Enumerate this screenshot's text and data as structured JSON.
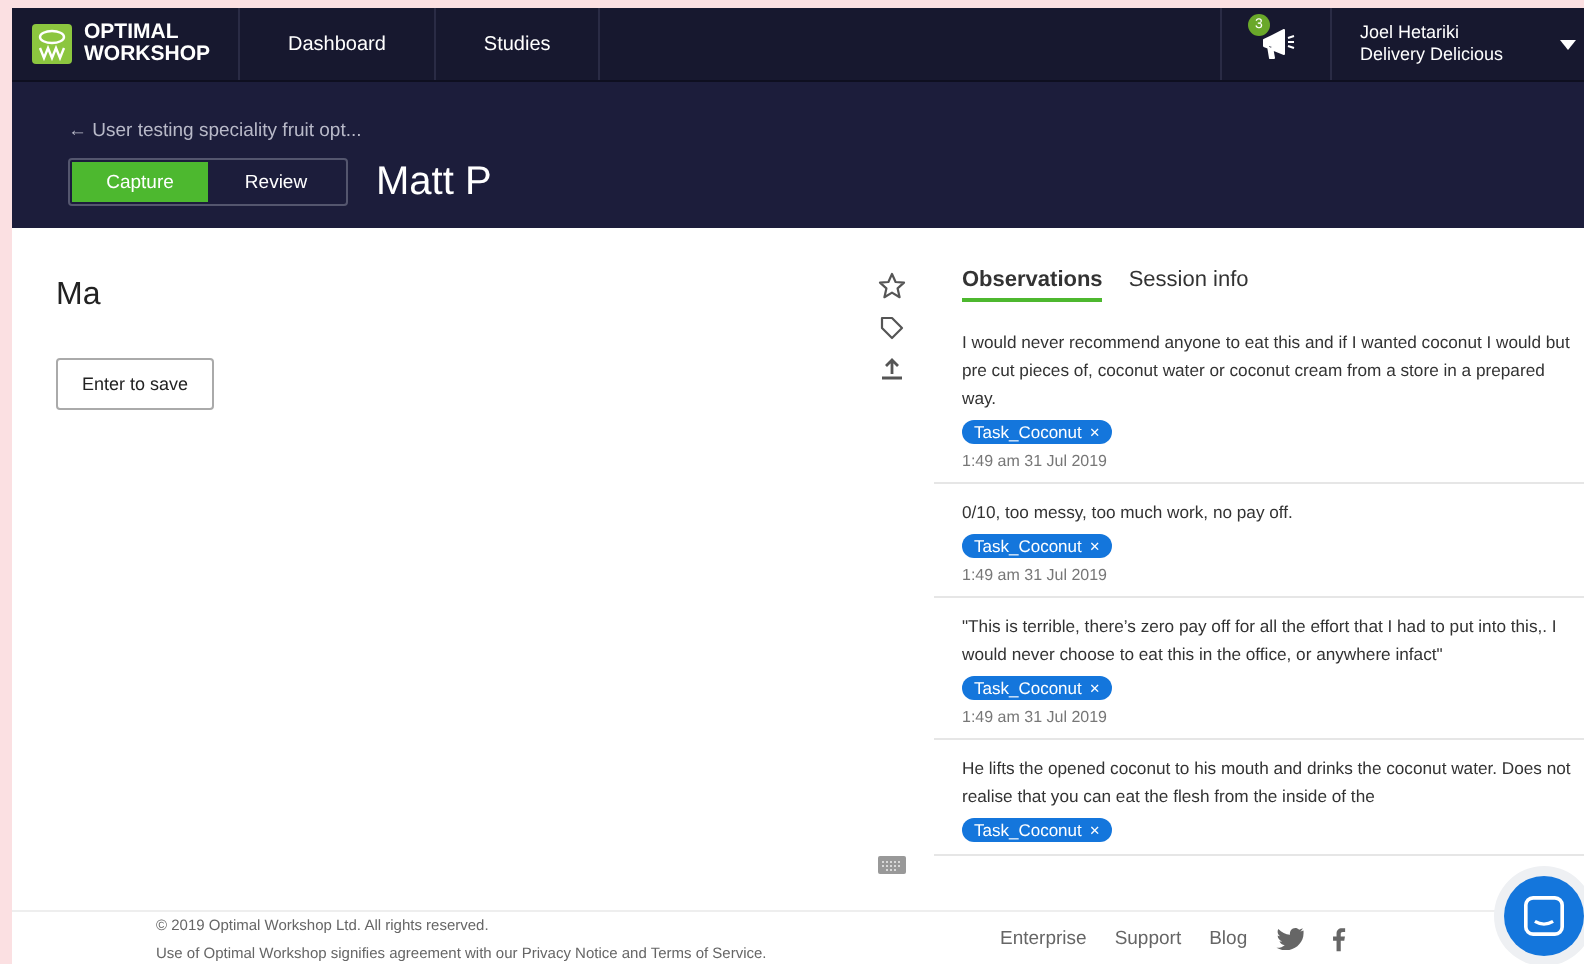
{
  "topbar": {
    "logo": [
      "OPTIMAL",
      "WORKSHOP"
    ],
    "nav": [
      {
        "label": "Dashboard"
      },
      {
        "label": "Studies"
      }
    ],
    "notifications": {
      "count": "3"
    },
    "user": {
      "name": "Joel Hetariki",
      "org": "Delivery Delicious"
    }
  },
  "subheader": {
    "back_link": "← User testing speciality fruit opt...",
    "modes": [
      {
        "label": "Capture",
        "selected": true
      },
      {
        "label": "Review",
        "selected": false
      }
    ],
    "participant": "Matt P"
  },
  "note": {
    "value": "Ma",
    "save_button": "Enter to save"
  },
  "panel": {
    "tabs": [
      {
        "label": "Observations",
        "selected": true
      },
      {
        "label": "Session info",
        "selected": false
      }
    ],
    "observations": [
      {
        "text": "I would never recommend anyone to eat this and if I wanted coconut I would but pre cut pieces of, coconut water or coconut cream from a store in a prepared way.",
        "tags": [
          {
            "label": "Task_Coconut",
            "remove": "×"
          }
        ],
        "time": "1:49 am 31 Jul 2019"
      },
      {
        "text": "0/10, too messy, too much work, no pay off.",
        "tags": [
          {
            "label": "Task_Coconut",
            "remove": "×"
          }
        ],
        "time": "1:49 am 31 Jul 2019"
      },
      {
        "text": "\"This is terrible, there’s zero pay off for all the effort that I had to put into this,. I would never choose to eat this in the office, or anywhere infact\"",
        "tags": [
          {
            "label": "Task_Coconut",
            "remove": "×"
          }
        ],
        "time": "1:49 am 31 Jul 2019"
      },
      {
        "text": "He lifts the opened coconut to his mouth and drinks the coconut water. Does not realise that you can eat the flesh from the inside of the",
        "tags": [
          {
            "label": "Task_Coconut",
            "remove": "×"
          }
        ]
      }
    ]
  },
  "footer": {
    "copyright": "© 2019 Optimal Workshop Ltd. All rights reserved.",
    "terms": "Use of Optimal Workshop signifies agreement with our Privacy Notice and Terms of Service.",
    "links": [
      "Enterprise",
      "Support",
      "Blog"
    ]
  }
}
